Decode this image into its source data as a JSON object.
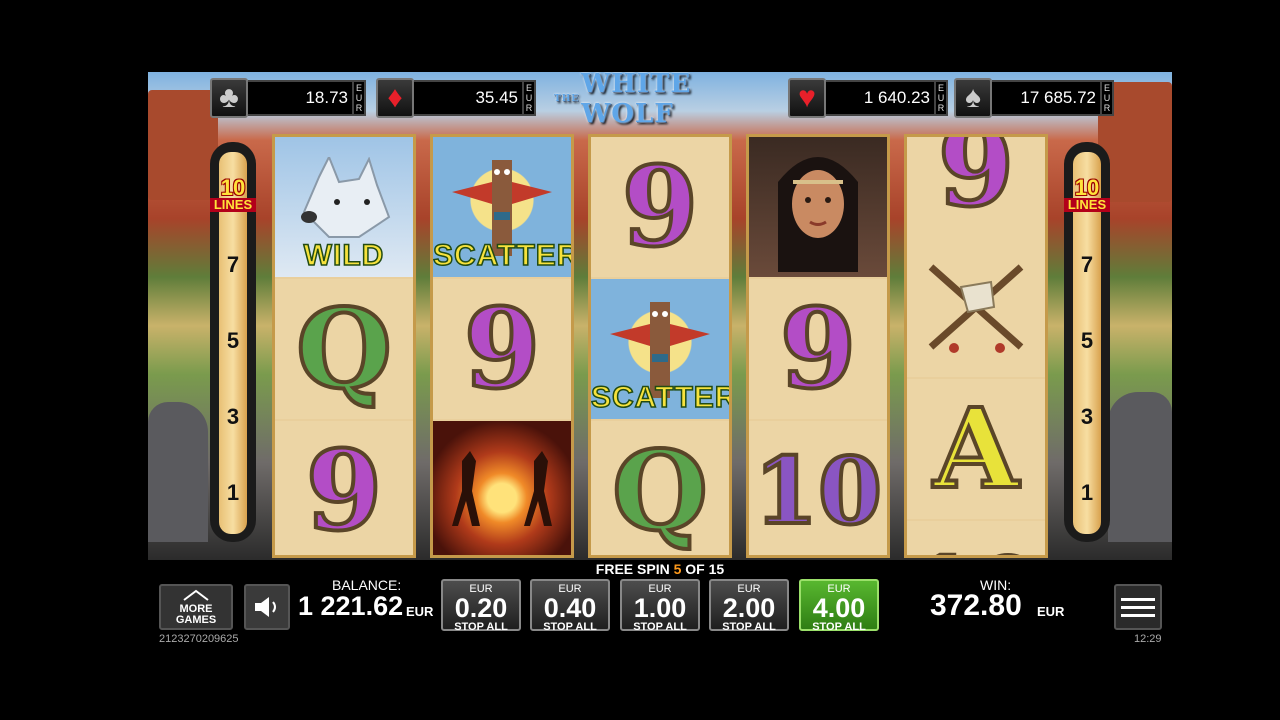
{
  "jackpots": [
    {
      "suit": "club",
      "glyph": "♣",
      "color": "#bbbbbb",
      "value": "18.73",
      "currency": [
        "E",
        "U",
        "R"
      ]
    },
    {
      "suit": "diamond",
      "glyph": "♦",
      "color": "#e8202a",
      "value": "35.45",
      "currency": [
        "E",
        "U",
        "R"
      ]
    },
    {
      "suit": "heart",
      "glyph": "♥",
      "color": "#e8202a",
      "value": "1 640.23",
      "currency": [
        "E",
        "U",
        "R"
      ]
    },
    {
      "suit": "spade",
      "glyph": "♠",
      "color": "#bbbbbb",
      "value": "17 685.72",
      "currency": [
        "E",
        "U",
        "R"
      ]
    }
  ],
  "logo": {
    "title": "WHITE WOLF",
    "prefix": "THE"
  },
  "lines": {
    "count": "10",
    "label": "LINES",
    "markers": [
      "7",
      "5",
      "3",
      "1"
    ]
  },
  "reels": [
    [
      {
        "type": "wolf",
        "label": "WILD"
      },
      {
        "type": "Q"
      },
      {
        "type": "9"
      }
    ],
    [
      {
        "type": "totem",
        "label": "SCATTER"
      },
      {
        "type": "9"
      },
      {
        "type": "fire-dancers"
      }
    ],
    [
      {
        "type": "9"
      },
      {
        "type": "totem",
        "label": "SCATTER"
      },
      {
        "type": "Q"
      }
    ],
    [
      {
        "type": "woman"
      },
      {
        "type": "9"
      },
      {
        "type": "10"
      }
    ],
    [
      {
        "type": "9"
      },
      {
        "type": "axes"
      },
      {
        "type": "A"
      }
    ]
  ],
  "free_spin": {
    "prefix": "FREE SPIN",
    "current": "5",
    "of": "OF",
    "total": "15"
  },
  "more_games": {
    "line1": "MORE",
    "line2": "GAMES"
  },
  "game_id": "2123270209625",
  "balance": {
    "label": "BALANCE:",
    "value": "1 221.62",
    "currency": "EUR"
  },
  "bets": [
    {
      "currency": "EUR",
      "amount": "0.20",
      "stop": "STOP ALL",
      "active": false
    },
    {
      "currency": "EUR",
      "amount": "0.40",
      "stop": "STOP ALL",
      "active": false
    },
    {
      "currency": "EUR",
      "amount": "1.00",
      "stop": "STOP ALL",
      "active": false
    },
    {
      "currency": "EUR",
      "amount": "2.00",
      "stop": "STOP ALL",
      "active": false
    },
    {
      "currency": "EUR",
      "amount": "4.00",
      "stop": "STOP ALL",
      "active": true
    }
  ],
  "win": {
    "label": "WIN:",
    "value": "372.80",
    "currency": "EUR"
  },
  "clock": "12:29",
  "colors": {
    "active_bet": "#3f9a1f",
    "free_spin_current": "#ff9a1c",
    "lines_badge": "#ffe23a"
  }
}
